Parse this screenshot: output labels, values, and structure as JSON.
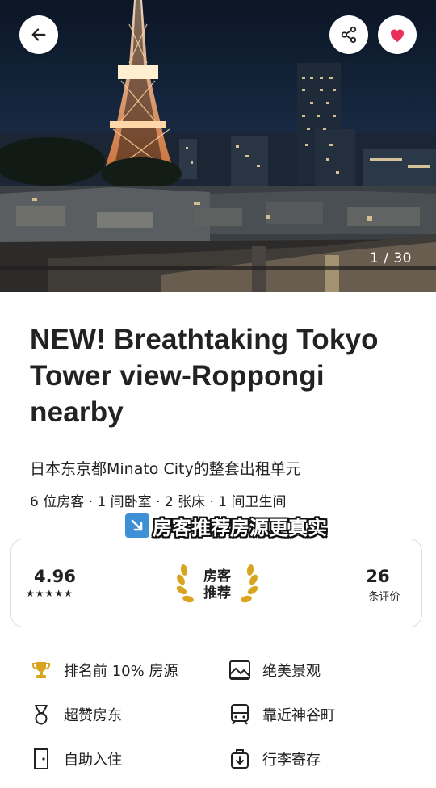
{
  "gallery": {
    "counter": "1 / 30",
    "back_icon": "arrow-left-icon",
    "share_icon": "share-icon",
    "favorite_icon": "heart-icon",
    "favorite_color": "#e8305a"
  },
  "listing": {
    "title": "NEW! Breathtaking Tokyo Tower view-Roppongi nearby",
    "subtitle": "日本东京都Minato City的整套出租单元",
    "details": "6 位房客 · 1 间卧室 · 2 张床 · 1 间卫生间"
  },
  "overlay_caption": "房客推荐房源更真实",
  "rating_card": {
    "rating": "4.96",
    "stars": "★★★★★",
    "badge_line1": "房客",
    "badge_line2": "推荐",
    "review_count": "26",
    "review_label": "条评价"
  },
  "amenities": [
    {
      "icon": "trophy-icon",
      "label": "排名前 10% 房源"
    },
    {
      "icon": "landscape-icon",
      "label": "绝美景观"
    },
    {
      "icon": "medal-icon",
      "label": "超赞房东"
    },
    {
      "icon": "train-icon",
      "label": "靠近神谷町"
    },
    {
      "icon": "door-icon",
      "label": "自助入住"
    },
    {
      "icon": "luggage-icon",
      "label": "行李寄存"
    }
  ]
}
